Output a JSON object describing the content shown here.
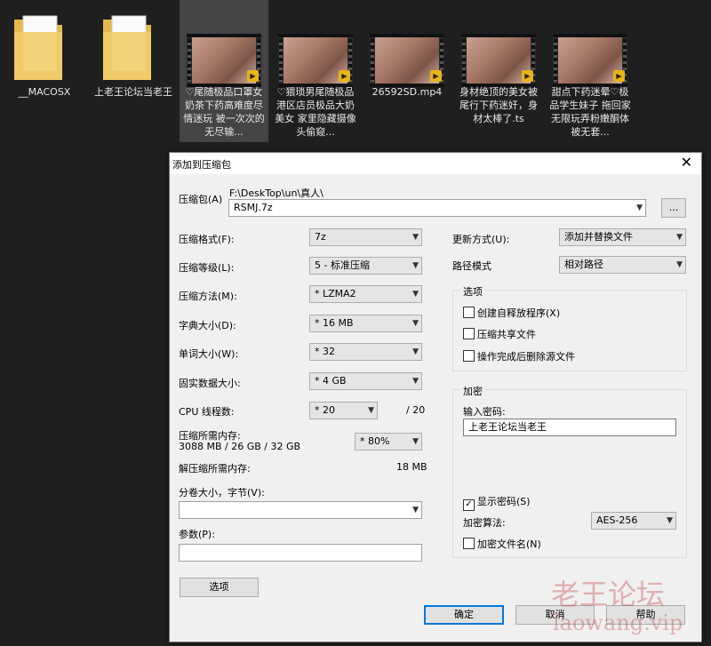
{
  "explorer": {
    "items": [
      {
        "name": "__MACOSX",
        "type": "folder"
      },
      {
        "name": "上老王论坛当老王",
        "type": "folder"
      },
      {
        "name": "♡尾随极品口罩女奶茶下药高难度尽情迷玩 被一次次的无尽输...",
        "type": "video"
      },
      {
        "name": "♡猥琐男尾随极品港区店员极品大奶美女 家里隐藏摄像头偷窥...",
        "type": "video"
      },
      {
        "name": "26592SD.mp4",
        "type": "video"
      },
      {
        "name": "身材绝顶的美女被尾行下药迷奸，身材太棒了.ts",
        "type": "video"
      },
      {
        "name": "甜点下药迷晕♡极品学生妹子 拖回家无限玩弄粉嫩酮体 被无套...",
        "type": "video"
      }
    ],
    "badge_text": "Player"
  },
  "dialog": {
    "title": "添加到压缩包",
    "close": "✕",
    "archive": {
      "label": "压缩包(A)",
      "path": "F:\\DeskTop\\un\\真人\\",
      "value": "RSMJ.7z",
      "browse": "..."
    },
    "format": {
      "label": "压缩格式(F):",
      "value": "7z"
    },
    "level": {
      "label": "压缩等级(L):",
      "value": "5 - 标准压缩"
    },
    "method": {
      "label": "压缩方法(M):",
      "value": "* LZMA2"
    },
    "dict": {
      "label": "字典大小(D):",
      "value": "* 16 MB"
    },
    "word": {
      "label": "单词大小(W):",
      "value": "* 32"
    },
    "solid": {
      "label": "固实数据大小:",
      "value": "* 4 GB"
    },
    "cpu": {
      "label": "CPU 线程数:",
      "value": "* 20",
      "max": "/ 20"
    },
    "mem": {
      "label": "压缩所需内存:",
      "detail": "3088 MB / 26 GB / 32 GB",
      "value": "* 80%"
    },
    "decomp": {
      "label": "解压缩所需内存:",
      "value": "18 MB"
    },
    "volume": {
      "label": "分卷大小，字节(V):",
      "value": ""
    },
    "params": {
      "label": "参数(P):",
      "value": ""
    },
    "options_button": "选项",
    "update": {
      "label": "更新方式(U):",
      "value": "添加并替换文件"
    },
    "pathmode": {
      "label": "路径模式",
      "value": "相对路径"
    },
    "options_group": {
      "title": "选项",
      "sfx": "创建自释放程序(X)",
      "shared": "压缩共享文件",
      "delete": "操作完成后删除源文件"
    },
    "encryption": {
      "title": "加密",
      "password_label": "输入密码:",
      "password": "上老王论坛当老王",
      "show_password": "显示密码(S)",
      "method_label": "加密算法:",
      "method": "AES-256",
      "encrypt_names": "加密文件名(N)"
    },
    "buttons": {
      "ok": "确定",
      "cancel": "取消",
      "help": "帮助"
    }
  },
  "watermark": {
    "cn": "老王论坛",
    "en": "laowang.vip"
  }
}
